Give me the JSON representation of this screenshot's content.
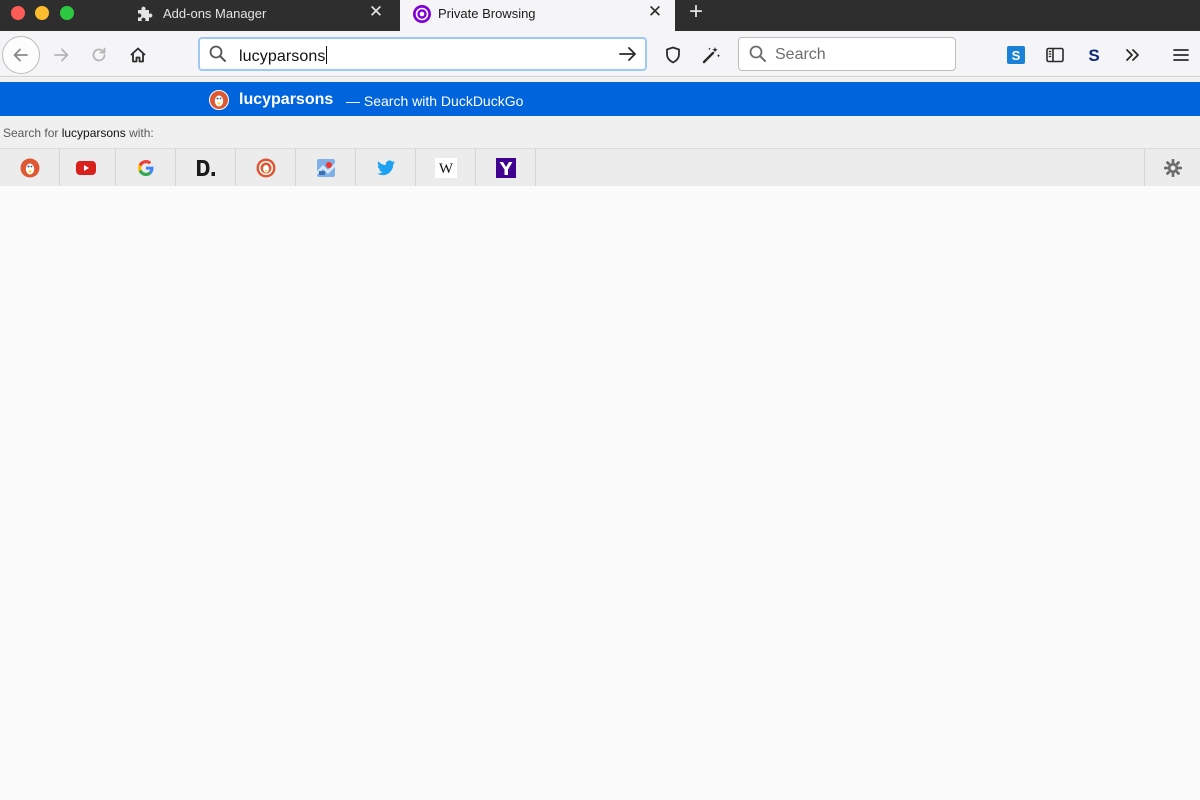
{
  "window": {
    "tabs": [
      {
        "label": "Add-ons Manager",
        "icon": "puzzle-piece-icon",
        "active": false
      },
      {
        "label": "Private Browsing",
        "icon": "private-browsing-icon",
        "active": true
      }
    ]
  },
  "toolbar": {
    "url_value": "lucyparsons",
    "search_placeholder": "Search"
  },
  "suggestion": {
    "term": "lucyparsons",
    "description": "— Search with DuckDuckGo",
    "engine_icon": "duckduckgo-icon"
  },
  "search_for": {
    "prefix": "Search for",
    "term": "lucyparsons",
    "suffix": "with:"
  },
  "engines": [
    {
      "name": "duckduckgo",
      "icon": "duckduckgo-icon"
    },
    {
      "name": "youtube",
      "icon": "youtube-icon"
    },
    {
      "name": "google",
      "icon": "google-icon"
    },
    {
      "name": "dictionary",
      "icon": "dictionary-icon"
    },
    {
      "name": "duckduckgo-alt",
      "icon": "duckduckgo-alt-icon"
    },
    {
      "name": "map",
      "icon": "map-icon"
    },
    {
      "name": "twitter",
      "icon": "twitter-icon"
    },
    {
      "name": "wikipedia",
      "icon": "wikipedia-icon"
    },
    {
      "name": "yahoo",
      "icon": "yahoo-icon"
    }
  ],
  "colors": {
    "highlight": "#0064dc",
    "private_purple": "#8000d7",
    "tabbar": "#2e2e2e"
  }
}
